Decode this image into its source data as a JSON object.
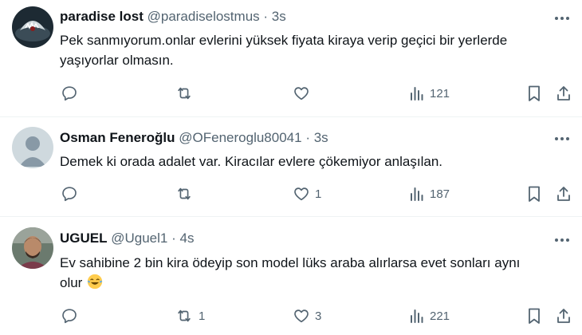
{
  "colors": {
    "text": "#0f1419",
    "muted": "#536471",
    "divider": "#eff3f4"
  },
  "tweets": [
    {
      "name": "paradise lost",
      "handle": "@paradiselostmus",
      "separator": "·",
      "time": "3s",
      "text_lines": [
        "Pek sanmıyorum.onlar evlerini yüksek fiyata kiraya verip geçici bir yerlerde",
        "yaşıyorlar olmasın."
      ],
      "replies": "",
      "retweets": "",
      "likes": "",
      "views": "121",
      "avatar": "shark-image-avatar"
    },
    {
      "name": "Osman Feneroğlu",
      "handle": "@OFeneroglu80041",
      "separator": "·",
      "time": "3s",
      "text_lines": [
        "Demek ki orada adalet var. Kiracılar evlere çökemiyor anlaşılan."
      ],
      "replies": "",
      "retweets": "",
      "likes": "1",
      "views": "187",
      "avatar": "default-person-avatar"
    },
    {
      "name": "UGUEL",
      "handle": "@Uguel1",
      "separator": "·",
      "time": "4s",
      "text_lines": [
        "Ev sahibine 2 bin kira ödeyip son model lüks araba alırlarsa evet sonları aynı",
        "olur"
      ],
      "emoji": "face-with-tears-of-joy",
      "replies": "",
      "retweets": "1",
      "likes": "3",
      "views": "221",
      "avatar": "man-photo-avatar"
    }
  ]
}
